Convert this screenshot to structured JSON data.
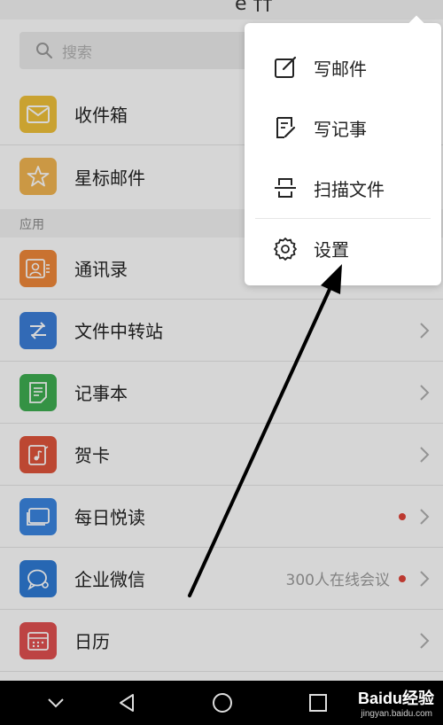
{
  "topbar": {
    "fragment": "е ††"
  },
  "search": {
    "placeholder": "搜索"
  },
  "mail_items": [
    {
      "label": "收件箱",
      "icon": "envelope-icon",
      "color": "#f0c23b"
    },
    {
      "label": "星标邮件",
      "icon": "star-icon",
      "color": "#f2b552"
    }
  ],
  "section_title": "应用",
  "apps": [
    {
      "label": "通讯录",
      "icon": "contacts-icon",
      "color": "#f0883a"
    },
    {
      "label": "文件中转站",
      "icon": "transfer-icon",
      "color": "#3c7fd9"
    },
    {
      "label": "记事本",
      "icon": "notepad-icon",
      "color": "#3fae52"
    },
    {
      "label": "贺卡",
      "icon": "greeting-card-icon",
      "color": "#e0553c"
    },
    {
      "label": "每日悦读",
      "icon": "daily-reading-icon",
      "color": "#3b86e2"
    },
    {
      "label": "企业微信",
      "icon": "wework-icon",
      "color": "#2f7bd6",
      "extra": "300人在线会议"
    },
    {
      "label": "日历",
      "icon": "calendar-icon",
      "color": "#e25050"
    }
  ],
  "menu": [
    {
      "label": "写邮件",
      "icon": "compose-icon"
    },
    {
      "label": "写记事",
      "icon": "note-icon"
    },
    {
      "label": "扫描文件",
      "icon": "scan-icon"
    },
    {
      "label": "设置",
      "icon": "gear-icon"
    }
  ],
  "watermark": {
    "logo": "Baidu经验",
    "url": "jingyan.baidu.com"
  },
  "colors": {
    "badge": "#e0453a",
    "navbar": "#000000"
  }
}
